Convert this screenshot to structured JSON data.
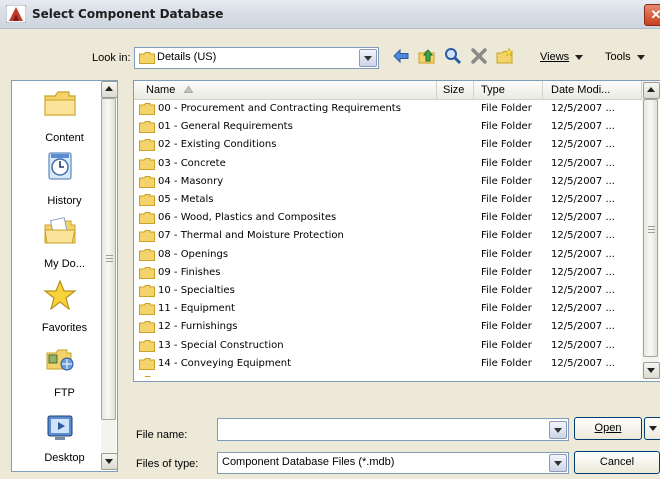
{
  "window": {
    "title": "Select Component Database",
    "close_glyph": "✕"
  },
  "toolbar": {
    "look_in_label": "Look in:",
    "look_in_value": "Details (US)",
    "views_label": "Views",
    "tools_label": "Tools",
    "icons": [
      "back-icon",
      "up-folder-icon",
      "search-web-icon",
      "delete-icon",
      "new-folder-icon"
    ]
  },
  "places": [
    {
      "label": "Content",
      "icon": "folder-icon"
    },
    {
      "label": "History",
      "icon": "history-icon"
    },
    {
      "label": "My Do...",
      "icon": "my-documents-icon"
    },
    {
      "label": "Favorites",
      "icon": "favorites-icon"
    },
    {
      "label": "FTP",
      "icon": "ftp-icon"
    },
    {
      "label": "Desktop",
      "icon": "desktop-icon"
    }
  ],
  "columns": {
    "name": "Name",
    "size": "Size",
    "type": "Type",
    "date": "Date Modi..."
  },
  "files": [
    {
      "name": "00 - Procurement and Contracting Requirements",
      "type": "File Folder",
      "date": "12/5/2007 ..."
    },
    {
      "name": "01 - General Requirements",
      "type": "File Folder",
      "date": "12/5/2007 ..."
    },
    {
      "name": "02 - Existing Conditions",
      "type": "File Folder",
      "date": "12/5/2007 ..."
    },
    {
      "name": "03 - Concrete",
      "type": "File Folder",
      "date": "12/5/2007 ..."
    },
    {
      "name": "04 - Masonry",
      "type": "File Folder",
      "date": "12/5/2007 ..."
    },
    {
      "name": "05 - Metals",
      "type": "File Folder",
      "date": "12/5/2007 ..."
    },
    {
      "name": "06 - Wood, Plastics and Composites",
      "type": "File Folder",
      "date": "12/5/2007 ..."
    },
    {
      "name": "07 - Thermal and Moisture Protection",
      "type": "File Folder",
      "date": "12/5/2007 ..."
    },
    {
      "name": "08 - Openings",
      "type": "File Folder",
      "date": "12/5/2007 ..."
    },
    {
      "name": "09 - Finishes",
      "type": "File Folder",
      "date": "12/5/2007 ..."
    },
    {
      "name": "10 - Specialties",
      "type": "File Folder",
      "date": "12/5/2007 ..."
    },
    {
      "name": "11 - Equipment",
      "type": "File Folder",
      "date": "12/5/2007 ..."
    },
    {
      "name": "12 - Furnishings",
      "type": "File Folder",
      "date": "12/5/2007 ..."
    },
    {
      "name": "13 - Special Construction",
      "type": "File Folder",
      "date": "12/5/2007 ..."
    },
    {
      "name": "14 - Conveying Equipment",
      "type": "File Folder",
      "date": "12/5/2007 ..."
    }
  ],
  "form": {
    "file_name_label": "File name:",
    "file_name_value": "",
    "file_type_label": "Files of type:",
    "file_type_value": "Component Database Files (*.mdb)",
    "open_label": "Open",
    "cancel_label": "Cancel"
  },
  "colors": {
    "folder": "#f5d36b",
    "folder_edge": "#c9a227",
    "accent": "#003c74",
    "close": "#c7401f"
  }
}
